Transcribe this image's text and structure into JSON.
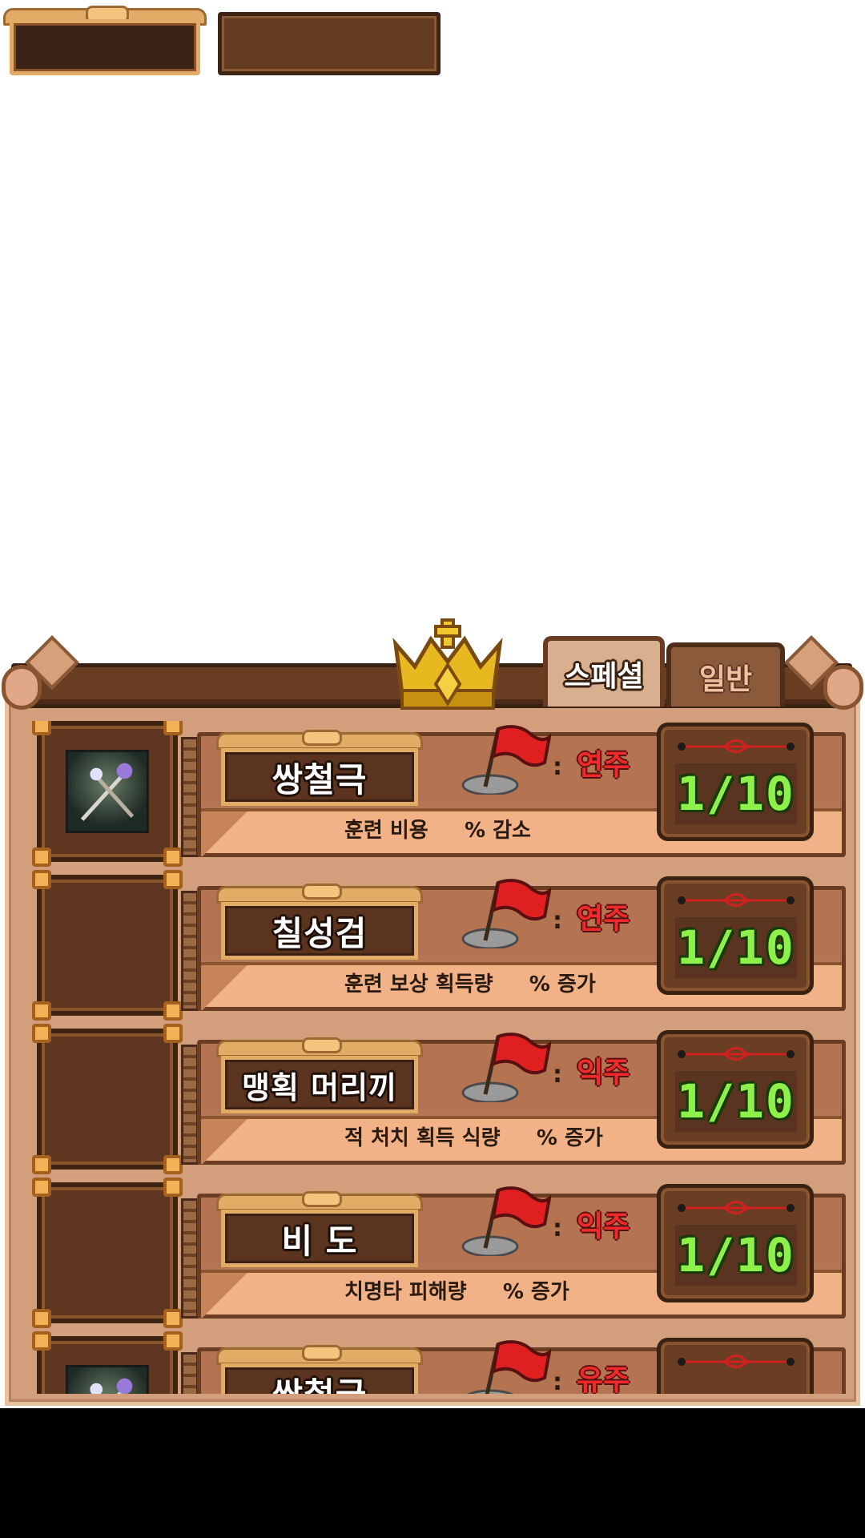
{
  "header_plates": {
    "left_value": "",
    "right_value": ""
  },
  "tabs": [
    {
      "label": "스페셜",
      "active": true
    },
    {
      "label": "일반",
      "active": false
    }
  ],
  "skills": [
    {
      "name": "쌍철극",
      "owner": "연주",
      "description": "훈련 비용     % 감소",
      "level": "1/10",
      "icon": "crossed-spears-icon"
    },
    {
      "name": "칠성검",
      "owner": "연주",
      "description": "훈련 보상 획득량     % 증가",
      "level": "1/10",
      "icon": ""
    },
    {
      "name": "맹획 머리끼",
      "owner": "익주",
      "description": "적 처치 획득 식량     % 증가",
      "level": "1/10",
      "icon": ""
    },
    {
      "name": "비 도",
      "owner": "익주",
      "description": "치명타 피해량     % 증가",
      "level": "1/10",
      "icon": ""
    },
    {
      "name": "쌍철극",
      "owner": "유주",
      "description": "",
      "level": "",
      "icon": "crossed-spears-icon"
    }
  ],
  "colors": {
    "owner_text": "#ee2a2a",
    "level_text": "#8ef04a",
    "panel_bg": "#d29e7c"
  }
}
